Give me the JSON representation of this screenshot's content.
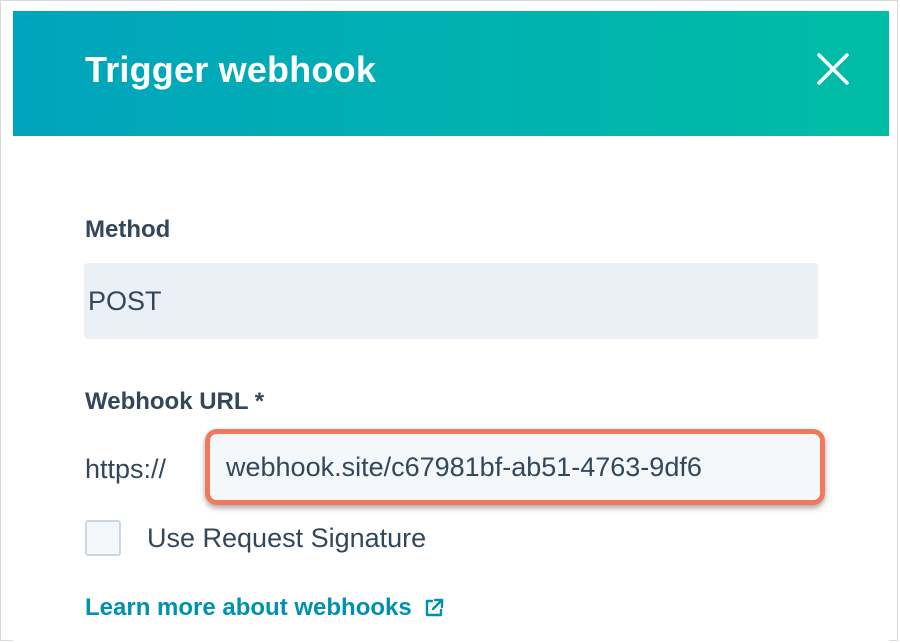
{
  "dialog": {
    "title": "Trigger webhook",
    "header_gradient": [
      "#00a4bd",
      "#00bda5"
    ]
  },
  "method": {
    "label": "Method",
    "value": "POST"
  },
  "webhook_url": {
    "label": "Webhook URL *",
    "prefix": "https://",
    "value": "webhook.site/c67981bf-ab51-4763-9df6",
    "highlight_color": "#f2785d"
  },
  "request_signature": {
    "label": "Use Request Signature",
    "checked": false
  },
  "learn_more": {
    "label": "Learn more about webhooks",
    "icon": "external-link-icon",
    "color": "#0091ae"
  },
  "icons": {
    "close": "close-icon"
  }
}
